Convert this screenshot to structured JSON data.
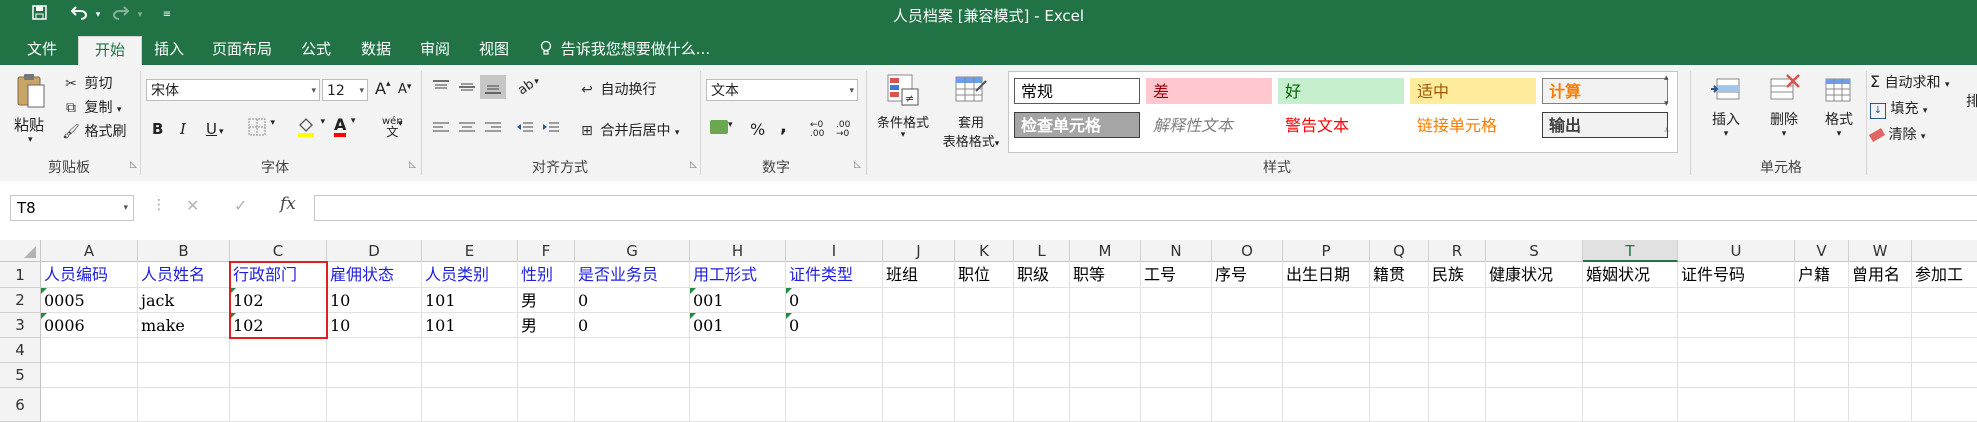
{
  "window": {
    "title": "人员档案  [兼容模式] - Excel",
    "qat_icons": [
      "save-icon",
      "undo-icon",
      "undo-dropdown-icon",
      "redo-icon",
      "customize-qat-icon"
    ]
  },
  "tabs": [
    "文件",
    "开始",
    "插入",
    "页面布局",
    "公式",
    "数据",
    "审阅",
    "视图"
  ],
  "active_tab": "开始",
  "tell_me": "告诉我您想要做什么...",
  "ribbon": {
    "clipboard": {
      "label": "剪贴板",
      "paste": "粘贴",
      "cut": "剪切",
      "copy": "复制",
      "format_painter": "格式刷"
    },
    "font": {
      "label": "字体",
      "font_name": "宋体",
      "font_size": "12",
      "grow": "A",
      "shrink": "A",
      "bold": "B",
      "italic": "I",
      "underline": "U",
      "font_color_glyph": "A",
      "phonetic": "wén"
    },
    "alignment": {
      "label": "对齐方式",
      "wrap": "自动换行",
      "merge": "合并后居中"
    },
    "number": {
      "label": "数字",
      "format": "文本",
      "percent": "%",
      "comma": ","
    },
    "styles": {
      "label": "样式",
      "conditional": "条件格式",
      "table_line1": "套用",
      "table_line2": "表格格式",
      "cells": [
        {
          "text": "常规",
          "bg": "#ffffff",
          "fg": "#000000",
          "border": "#5b5b5b"
        },
        {
          "text": "差",
          "bg": "#ffc7ce",
          "fg": "#9c0006",
          "border": "#ffc7ce"
        },
        {
          "text": "好",
          "bg": "#c6efce",
          "fg": "#006100",
          "border": "#c6efce"
        },
        {
          "text": "适中",
          "bg": "#ffeb9c",
          "fg": "#9c5700",
          "border": "#ffeb9c"
        },
        {
          "text": "计算",
          "bg": "#f2f2f2",
          "fg": "#fa7d00",
          "border": "#7f7f7f"
        },
        {
          "text": "检查单元格",
          "bg": "#a5a5a5",
          "fg": "#ffffff",
          "border": "#3f3f3f"
        },
        {
          "text": "解释性文本",
          "bg": "#ffffff",
          "fg": "#7f7f7f",
          "border": "#ffffff"
        },
        {
          "text": "警告文本",
          "bg": "#ffffff",
          "fg": "#ff0000",
          "border": "#ffffff"
        },
        {
          "text": "链接单元格",
          "bg": "#ffffff",
          "fg": "#fa7d00",
          "border": "#ffffff"
        },
        {
          "text": "输出",
          "bg": "#f2f2f2",
          "fg": "#3f3f3f",
          "border": "#3f3f3f"
        }
      ]
    },
    "cells": {
      "label": "单元格",
      "insert": "插入",
      "delete": "删除",
      "format": "格式"
    },
    "editing": {
      "autosum": "自动求和",
      "fill": "填充",
      "clear": "清除",
      "sort_partial": "排"
    }
  },
  "formula_bar": {
    "name_box": "T8",
    "cancel": "✕",
    "enter": "✓",
    "fx": "fx",
    "value": ""
  },
  "sheet": {
    "columns": [
      "A",
      "B",
      "C",
      "D",
      "E",
      "F",
      "G",
      "H",
      "I",
      "J",
      "K",
      "L",
      "M",
      "N",
      "O",
      "P",
      "Q",
      "R",
      "S",
      "T",
      "U",
      "V",
      "W",
      ""
    ],
    "selected_column": "T",
    "row_numbers": [
      "1",
      "2",
      "3",
      "4",
      "5",
      "6"
    ],
    "rows": [
      [
        "人员编码",
        "人员姓名",
        "行政部门",
        "雇佣状态",
        "人员类别",
        "性别",
        "是否业务员",
        "用工形式",
        "证件类型",
        "班组",
        "职位",
        "职级",
        "职等",
        "工号",
        "序号",
        "出生日期",
        "籍贯",
        "民族",
        "健康状况",
        "婚姻状况",
        "证件号码",
        "户籍",
        "曾用名",
        "参加工"
      ],
      [
        "0005",
        "jack",
        "102",
        "10",
        "101",
        "男",
        "0",
        "001",
        "0",
        "",
        "",
        "",
        "",
        "",
        "",
        "",
        "",
        "",
        "",
        "",
        "",
        "",
        "",
        ""
      ],
      [
        "0006",
        "make",
        "102",
        "10",
        "101",
        "男",
        "0",
        "001",
        "0",
        "",
        "",
        "",
        "",
        "",
        "",
        "",
        "",
        "",
        "",
        "",
        "",
        "",
        "",
        ""
      ]
    ],
    "blue_header_count": 9,
    "text_number_cols": [
      0,
      2,
      7,
      8
    ]
  },
  "colors": {
    "excel_green": "#217346",
    "header_blue": "#1f1fe0",
    "highlight_red": "#e02020"
  }
}
